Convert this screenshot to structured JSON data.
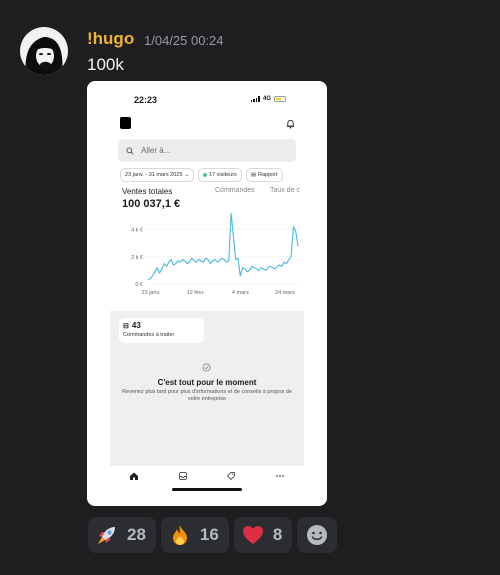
{
  "message": {
    "username": "!hugo",
    "timestamp": "1/04/25 00:24",
    "text": "100k"
  },
  "screenshot": {
    "status_time": "22:23",
    "network": "4G",
    "search_placeholder": "Aller à...",
    "filters": {
      "date_range": "23 janv. - 31 mars 2025",
      "visitors": "17 visiteurs",
      "report": "Rapport"
    },
    "metric_tabs": [
      "Ventes totales",
      "Commandes",
      "Taux de c"
    ],
    "total_sales": "100 037,1 €",
    "orders_count": "43",
    "orders_label": "Commandes à traiter",
    "empty_title": "C'est tout pour le moment",
    "empty_desc": "Revenez plus tard pour plus d'informations et de conseils à propos de votre entreprise",
    "nav_icons": [
      "home-icon",
      "inbox-icon",
      "tag-icon",
      "more-icon"
    ]
  },
  "chart_data": {
    "type": "line",
    "y_ticks": [
      "4 k €",
      "2 k €",
      "0 €"
    ],
    "x_ticks": [
      "23 janv.",
      "12 févr.",
      "4 mars",
      "24 mars"
    ],
    "ylim": [
      0,
      5000
    ],
    "series": [
      {
        "color": "#48b6df",
        "values": [
          300,
          400,
          600,
          900,
          1200,
          800,
          1100,
          1500,
          1300,
          1600,
          1800,
          1400,
          1500,
          1700,
          1600,
          1800,
          1700,
          1500,
          1600,
          1900,
          1700,
          1600,
          1800,
          1700,
          1600,
          1900,
          1800,
          1500,
          1700,
          1800,
          1600,
          1700,
          1900,
          1800,
          1600,
          1700,
          5200,
          3500,
          1800,
          1900,
          600,
          1200,
          1100,
          900,
          1000,
          1300,
          1200,
          1100,
          1000,
          1200,
          1100,
          1000,
          1200,
          1300,
          1200,
          1100,
          1300,
          1400,
          1300,
          1600,
          1500,
          1800,
          2000,
          4200,
          3900,
          2800
        ]
      }
    ]
  },
  "reactions": [
    {
      "emoji": "rocket-icon",
      "count": "28"
    },
    {
      "emoji": "fire-icon",
      "count": "16"
    },
    {
      "emoji": "heart-icon",
      "count": "8"
    }
  ]
}
